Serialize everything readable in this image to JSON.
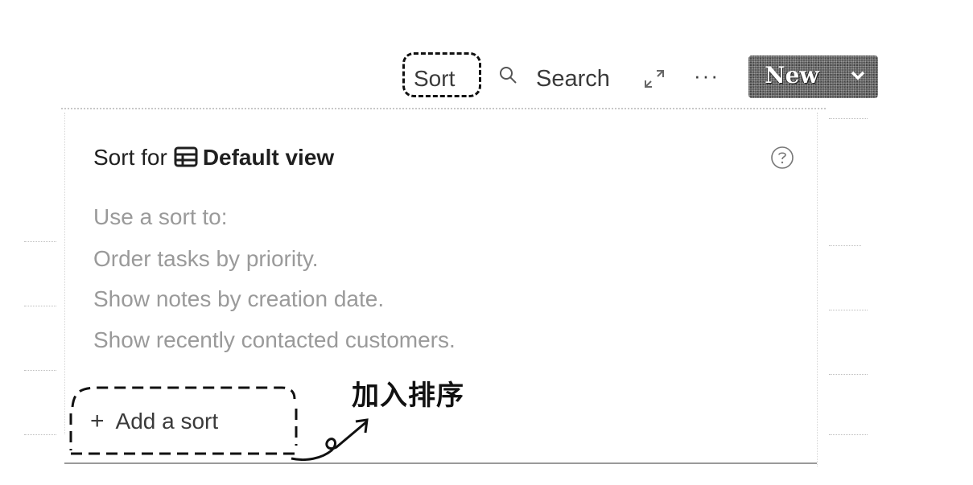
{
  "toolbar": {
    "sort_label": "Sort",
    "search_label": "Search",
    "more_label": "···",
    "new_label": "New",
    "icons": {
      "search": "search-icon",
      "expand": "expand-icon",
      "chevron": "chevron-down-icon"
    }
  },
  "popover": {
    "title_prefix": "Sort for",
    "view_name": "Default view",
    "view_icon": "table-icon",
    "help_icon": "help-circle-icon",
    "hints": [
      "Use a sort to:",
      "Order tasks by priority.",
      "Show notes by creation date.",
      "Show recently contacted customers."
    ],
    "add_sort_label": "Add a sort"
  },
  "annotation": {
    "text": "加入排序"
  },
  "colors": {
    "new_button": "#5e5e5e",
    "hint_text": "#9a9a9a",
    "title_text": "#1f1f1f"
  }
}
